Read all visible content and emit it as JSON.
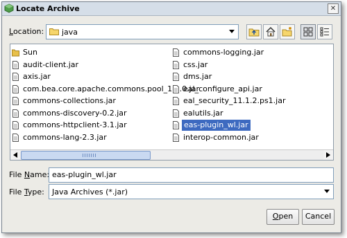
{
  "window": {
    "title": "Locate Archive",
    "close_glyph": "✕"
  },
  "location": {
    "label_prefix": "",
    "label_mnemonic": "L",
    "label_rest": "ocation:",
    "value": "java"
  },
  "toolbar": {
    "buttons": [
      "up-folder-icon",
      "home-icon",
      "new-folder-icon",
      "list-view-icon",
      "details-view-icon"
    ]
  },
  "files": {
    "column1": [
      {
        "name": "Sun",
        "type": "folder"
      },
      {
        "name": "audit-client.jar",
        "type": "file"
      },
      {
        "name": "axis.jar",
        "type": "file"
      },
      {
        "name": "com.bea.core.apache.commons.pool_1.3.0.jar",
        "type": "file"
      },
      {
        "name": "commons-collections.jar",
        "type": "file"
      },
      {
        "name": "commons-discovery-0.2.jar",
        "type": "file"
      },
      {
        "name": "commons-httpclient-3.1.jar",
        "type": "file"
      },
      {
        "name": "commons-lang-2.3.jar",
        "type": "file"
      }
    ],
    "column2": [
      {
        "name": "commons-logging.jar",
        "type": "file"
      },
      {
        "name": "css.jar",
        "type": "file"
      },
      {
        "name": "dms.jar",
        "type": "file"
      },
      {
        "name": "eal_configure_api.jar",
        "type": "file"
      },
      {
        "name": "eal_security_11.1.2.ps1.jar",
        "type": "file"
      },
      {
        "name": "ealutils.jar",
        "type": "file"
      },
      {
        "name": "eas-plugin_wl.jar",
        "type": "file",
        "selected": true
      },
      {
        "name": "interop-common.jar",
        "type": "file"
      }
    ]
  },
  "file_name": {
    "label_prefix": "File ",
    "label_mnemonic": "N",
    "label_rest": "ame:",
    "value": "eas-plugin_wl.jar"
  },
  "file_type": {
    "label_prefix": "File ",
    "label_mnemonic": "T",
    "label_rest": "ype:",
    "value": "Java Archives (*.jar)"
  },
  "buttons": {
    "open_mnemonic": "O",
    "open_rest": "pen",
    "cancel": "Cancel"
  },
  "colors": {
    "selection": "#3d6ac0",
    "folder": "#e8c04a"
  }
}
